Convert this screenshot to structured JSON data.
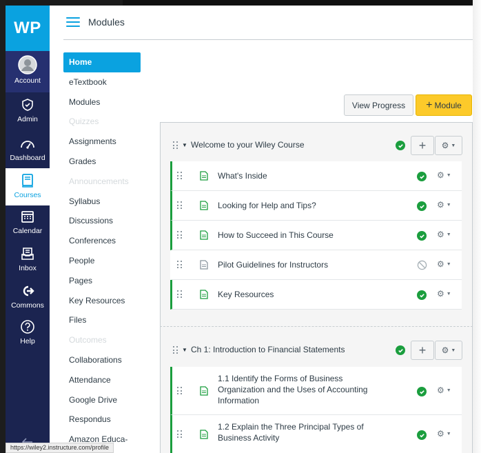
{
  "global_nav": {
    "logo": "WP",
    "items": [
      {
        "label": "Account",
        "icon": "account-icon"
      },
      {
        "label": "Admin",
        "icon": "admin-shield-icon"
      },
      {
        "label": "Dashboard",
        "icon": "dashboard-icon"
      },
      {
        "label": "Courses",
        "icon": "courses-book-icon"
      },
      {
        "label": "Calendar",
        "icon": "calendar-icon"
      },
      {
        "label": "Inbox",
        "icon": "inbox-icon"
      },
      {
        "label": "Commons",
        "icon": "commons-icon"
      },
      {
        "label": "Help",
        "icon": "help-icon"
      }
    ]
  },
  "header": {
    "breadcrumb": "Modules"
  },
  "course_nav": [
    {
      "label": "Home",
      "state": "active"
    },
    {
      "label": "eTextbook",
      "state": "normal"
    },
    {
      "label": "Modules",
      "state": "normal"
    },
    {
      "label": "Quizzes",
      "state": "disabled"
    },
    {
      "label": "Assignments",
      "state": "normal"
    },
    {
      "label": "Grades",
      "state": "normal"
    },
    {
      "label": "Announcements",
      "state": "disabled"
    },
    {
      "label": "Syllabus",
      "state": "normal"
    },
    {
      "label": "Discussions",
      "state": "normal"
    },
    {
      "label": "Conferences",
      "state": "normal"
    },
    {
      "label": "People",
      "state": "normal"
    },
    {
      "label": "Pages",
      "state": "normal"
    },
    {
      "label": "Key Resources",
      "state": "normal"
    },
    {
      "label": "Files",
      "state": "normal"
    },
    {
      "label": "Outcomes",
      "state": "disabled"
    },
    {
      "label": "Collaborations",
      "state": "normal"
    },
    {
      "label": "Attendance",
      "state": "normal"
    },
    {
      "label": "Google Drive",
      "state": "normal"
    },
    {
      "label": "Respondus",
      "state": "normal"
    },
    {
      "label": "Amazon Educa-",
      "state": "normal"
    }
  ],
  "toolbar": {
    "view_progress": "View Progress",
    "add_module": "Module"
  },
  "modules": [
    {
      "title": "Welcome to your Wiley Course",
      "items": [
        {
          "title": "What's Inside",
          "published": true
        },
        {
          "title": "Looking for Help and Tips?",
          "published": true
        },
        {
          "title": "How to Succeed in This Course",
          "published": true
        },
        {
          "title": "Pilot Guidelines for Instructors",
          "published": false
        },
        {
          "title": "Key Resources",
          "published": true
        }
      ]
    },
    {
      "title": "Ch 1: Introduction to Financial Statements",
      "items": [
        {
          "title_lines": [
            "1.1 Identify the Forms of Business",
            "Organization and the Uses of Accounting",
            "Information"
          ],
          "published": true
        },
        {
          "title_lines": [
            "1.2 Explain the Three Principal Types of",
            "Business Activity"
          ],
          "published": true
        }
      ]
    }
  ],
  "colors": {
    "accent": "#0aa2e0",
    "nav_bg": "#1b2450",
    "published_green": "#1b9e3e",
    "module_button": "#fcca2a"
  },
  "status_bar": "https://wiley2.instructure.com/profile"
}
